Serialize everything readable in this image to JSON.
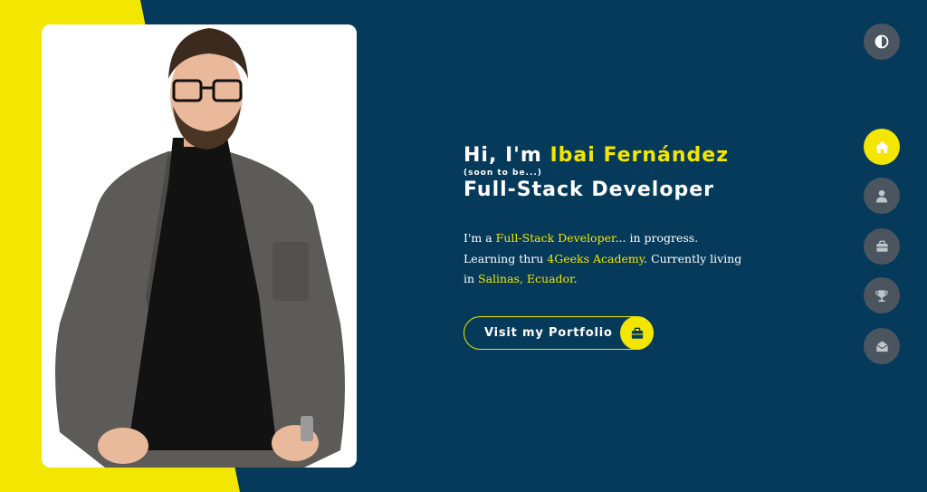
{
  "hero": {
    "greeting_prefix": "Hi, I'm ",
    "name": "Ibai Fernández",
    "subnote": "(soon to be...)",
    "role": "Full-Stack Developer",
    "bio": {
      "p1": "I'm a ",
      "role_link": "Full-Stack Developer",
      "p2": "... in progress. Learning thru ",
      "school_link": "4Geeks Academy",
      "p3": ". Currently living in ",
      "place_link": "Salinas, Ecuador",
      "p4": "."
    }
  },
  "cta": {
    "label": "Visit my Portfolio",
    "icon": "briefcase-icon"
  },
  "nav": {
    "theme_toggle_icon": "contrast-icon",
    "items": [
      {
        "icon": "home-icon",
        "active": true
      },
      {
        "icon": "user-icon",
        "active": false
      },
      {
        "icon": "briefcase-icon",
        "active": false
      },
      {
        "icon": "trophy-icon",
        "active": false
      },
      {
        "icon": "envelope-open-icon",
        "active": false
      }
    ]
  },
  "colors": {
    "background": "#063a5b",
    "accent": "#f3e600",
    "nav_inactive": "#4a5560"
  }
}
